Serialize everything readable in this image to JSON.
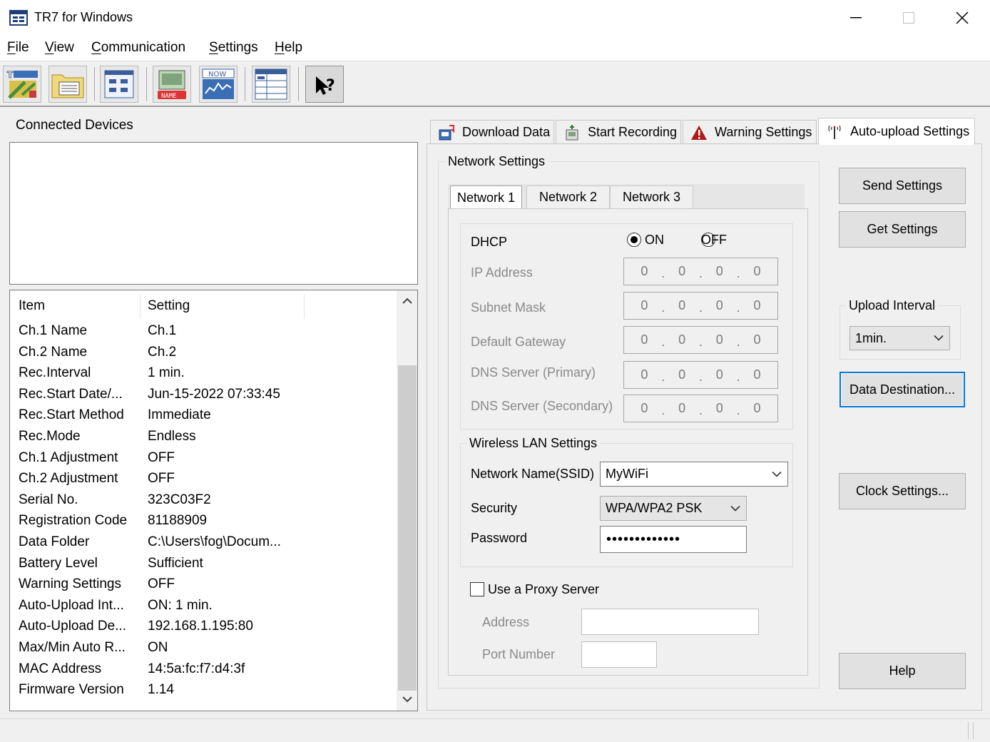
{
  "window": {
    "title": "TR7 for Windows",
    "minimize_glyph": "—",
    "maximize_glyph": "☐",
    "close_glyph": "✕"
  },
  "menu": [
    "File",
    "View",
    "Communication",
    "Settings",
    "Help"
  ],
  "toolbar": {
    "buttons": [
      "wizard-icon",
      "data-folder-icon",
      "device-list-icon",
      "device-name-icon",
      "current-readings-icon",
      "table-view-icon",
      "context-help-icon"
    ],
    "labels": {
      "now": "NOW",
      "name": "NAME"
    }
  },
  "left": {
    "connected_devices_label": "Connected Devices",
    "columns": {
      "item": "Item",
      "setting": "Setting"
    },
    "rows": [
      {
        "item": "Ch.1 Name",
        "setting": "Ch.1"
      },
      {
        "item": "Ch.2 Name",
        "setting": "Ch.2"
      },
      {
        "item": "Rec.Interval",
        "setting": "1 min."
      },
      {
        "item": "Rec.Start Date/...",
        "setting": "Jun-15-2022 07:33:45"
      },
      {
        "item": "Rec.Start Method",
        "setting": "Immediate"
      },
      {
        "item": "Rec.Mode",
        "setting": "Endless"
      },
      {
        "item": "Ch.1 Adjustment",
        "setting": "OFF"
      },
      {
        "item": "Ch.2 Adjustment",
        "setting": "OFF"
      },
      {
        "item": "Serial No.",
        "setting": "323C03F2"
      },
      {
        "item": "Registration Code",
        "setting": "81188909"
      },
      {
        "item": "Data Folder",
        "setting": "C:\\Users\\fog\\Docum..."
      },
      {
        "item": "Battery Level",
        "setting": "Sufficient"
      },
      {
        "item": "Warning Settings",
        "setting": "OFF"
      },
      {
        "item": "Auto-Upload Int...",
        "setting": "ON: 1 min."
      },
      {
        "item": "Auto-Upload De...",
        "setting": "192.168.1.195:80"
      },
      {
        "item": "Max/Min Auto R...",
        "setting": "ON"
      },
      {
        "item": "MAC Address",
        "setting": "14:5a:fc:f7:d4:3f"
      },
      {
        "item": "Firmware Version",
        "setting": "1.14"
      }
    ]
  },
  "tabs": {
    "download": "Download Data",
    "start": "Start Recording",
    "warning": "Warning Settings",
    "autoupload": "Auto-upload Settings",
    "active": "autoupload"
  },
  "network": {
    "group_title": "Network Settings",
    "subtabs": [
      "Network 1",
      "Network 2",
      "Network 3"
    ],
    "active_subtab": "Network 1",
    "dhcp_label": "DHCP",
    "dhcp_on": "ON",
    "dhcp_off": "OFF",
    "dhcp_value": "ON",
    "ip_label": "IP Address",
    "subnet_label": "Subnet Mask",
    "gateway_label": "Default Gateway",
    "dns1_label": "DNS Server (Primary)",
    "dns2_label": "DNS Server (Secondary)",
    "ip_octets": [
      "0",
      "0",
      "0",
      "0"
    ],
    "octet_separator": "."
  },
  "wireless": {
    "group_title": "Wireless LAN Settings",
    "ssid_label": "Network Name(SSID)",
    "ssid_value": "MyWiFi",
    "security_label": "Security",
    "security_value": "WPA/WPA2 PSK",
    "password_label": "Password",
    "password_value": "•••••••••••••"
  },
  "proxy": {
    "use_label": "Use a Proxy Server",
    "checked": false,
    "address_label": "Address",
    "port_label": "Port Number"
  },
  "side": {
    "send": "Send Settings",
    "get": "Get Settings",
    "upload_interval_title": "Upload Interval",
    "upload_interval_value": "1min.",
    "data_destination": "Data Destination...",
    "clock": "Clock Settings...",
    "help": "Help"
  },
  "colors": {
    "focus_border": "#0078d7",
    "warning_icon": "#b01818"
  }
}
